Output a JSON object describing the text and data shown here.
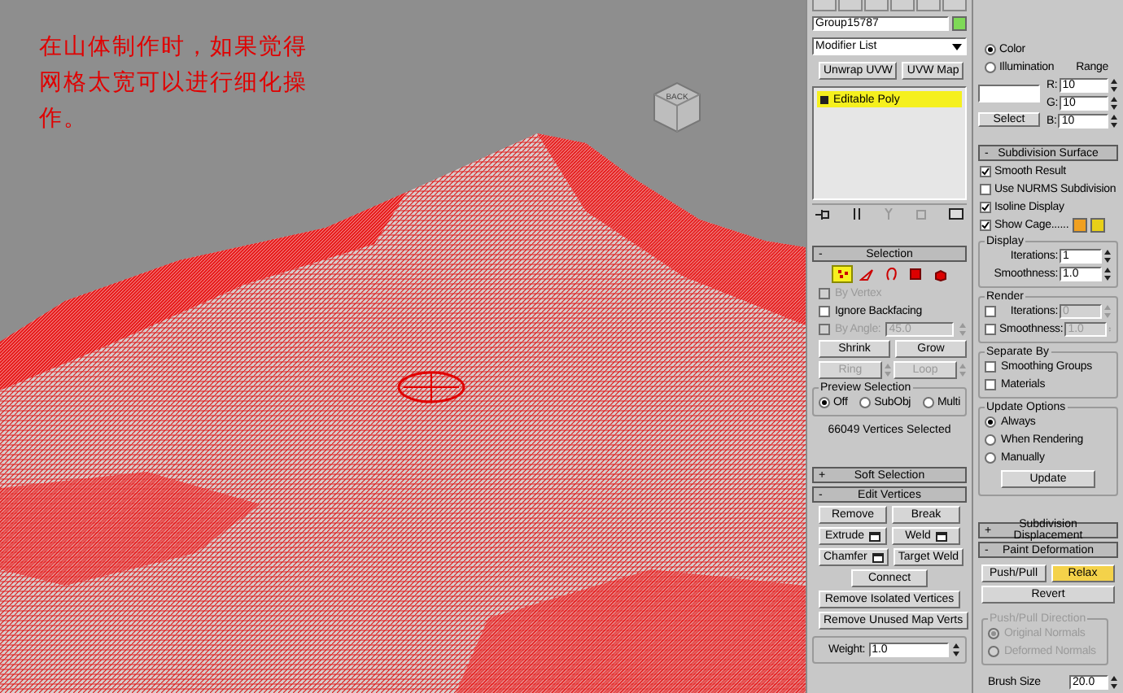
{
  "viewport": {
    "caption": "在山体制作时，如果觉得网格太宽可以进行细化操作。",
    "viewcube_label": "BACK"
  },
  "modifier_panel": {
    "object_name": "Group15787",
    "modifier_list": "Modifier List",
    "buttons": [
      "Unwrap UVW",
      "UVW Map"
    ],
    "stack": [
      {
        "label": "Editable Poly",
        "selected": true
      }
    ]
  },
  "selection": {
    "sign": "-",
    "title": "Selection",
    "levels": [
      {
        "kind": "vertex",
        "selected": true
      },
      {
        "kind": "edge",
        "selected": false
      },
      {
        "kind": "border",
        "selected": false
      },
      {
        "kind": "polygon",
        "selected": false
      },
      {
        "kind": "element",
        "selected": false
      }
    ],
    "options": [
      {
        "label": "By Vertex",
        "checked": false,
        "disabled": true
      },
      {
        "label": "Ignore Backfacing",
        "checked": false,
        "disabled": false
      }
    ],
    "by_angle": {
      "label": "By Angle:",
      "value": "45.0",
      "checked": false,
      "disabled": true
    },
    "shrink": "Shrink",
    "grow": "Grow",
    "ring": "Ring",
    "loop": "Loop",
    "preview": {
      "title": "Preview Selection",
      "options": [
        {
          "label": "Off",
          "selected": true
        },
        {
          "label": "SubObj",
          "selected": false
        },
        {
          "label": "Multi",
          "selected": false
        }
      ]
    },
    "status": "66049 Vertices Selected"
  },
  "soft_selection": {
    "sign": "+",
    "title": "Soft Selection"
  },
  "edit_vertices": {
    "sign": "-",
    "title": "Edit Vertices",
    "rows": [
      [
        {
          "label": "Remove",
          "settings": false
        },
        {
          "label": "Break",
          "settings": false
        }
      ],
      [
        {
          "label": "Extrude",
          "settings": true
        },
        {
          "label": "Weld",
          "settings": true
        }
      ],
      [
        {
          "label": "Chamfer",
          "settings": true
        },
        {
          "label": "Target Weld",
          "settings": false
        }
      ],
      [
        {
          "label": "Connect",
          "settings": false
        }
      ],
      [
        {
          "label": "Remove Isolated Vertices",
          "settings": false
        }
      ],
      [
        {
          "label": "Remove Unused Map Verts",
          "settings": false
        }
      ]
    ],
    "weight": {
      "label": "Weight:",
      "value": "1.0"
    }
  },
  "color_section": {
    "options": [
      {
        "label": "Color",
        "selected": true
      },
      {
        "label": "Illumination",
        "selected": false
      }
    ],
    "range_label": "Range",
    "channels": [
      {
        "label": "R:",
        "value": "10"
      },
      {
        "label": "G:",
        "value": "10"
      },
      {
        "label": "B:",
        "value": "10"
      }
    ],
    "select": "Select"
  },
  "subdivision_surface": {
    "sign": "-",
    "title": "Subdivision Surface",
    "checks": [
      {
        "label": "Smooth Result",
        "checked": true
      },
      {
        "label": "Use NURMS Subdivision",
        "checked": false
      },
      {
        "label": "Isoline Display",
        "checked": true
      },
      {
        "label": "Show Cage......",
        "checked": true
      }
    ],
    "cage_colors": [
      {
        "color": "#f0a020"
      },
      {
        "color": "#e8d018"
      }
    ],
    "display": {
      "title": "Display",
      "fields": [
        {
          "label": "Iterations:",
          "value": "1"
        },
        {
          "label": "Smoothness:",
          "value": "1.0"
        }
      ]
    },
    "render": {
      "title": "Render",
      "fields": [
        {
          "label": "Iterations:",
          "value": "0",
          "checked": false,
          "disabled": true
        },
        {
          "label": "Smoothness:",
          "value": "1.0",
          "checked": false,
          "disabled": true
        }
      ]
    },
    "separate_by": {
      "title": "Separate By",
      "checks": [
        {
          "label": "Smoothing Groups",
          "checked": false
        },
        {
          "label": "Materials",
          "checked": false
        }
      ]
    },
    "update_options": {
      "title": "Update Options",
      "options": [
        {
          "label": "Always",
          "selected": true
        },
        {
          "label": "When Rendering",
          "selected": false
        },
        {
          "label": "Manually",
          "selected": false
        }
      ],
      "button": "Update"
    }
  },
  "subdivision_displacement": {
    "sign": "+",
    "title": "Subdivision Displacement"
  },
  "paint_deformation": {
    "sign": "-",
    "title": "Paint Deformation",
    "modes": [
      {
        "label": "Push/Pull",
        "selected": false
      },
      {
        "label": "Relax",
        "selected": true
      }
    ],
    "revert": "Revert",
    "direction": {
      "title": "Push/Pull Direction",
      "disabled": true,
      "options": [
        {
          "label": "Original Normals",
          "selected": true
        },
        {
          "label": "Deformed Normals",
          "selected": false
        }
      ]
    },
    "brush_size": {
      "label": "Brush Size",
      "value": "20.0"
    }
  }
}
